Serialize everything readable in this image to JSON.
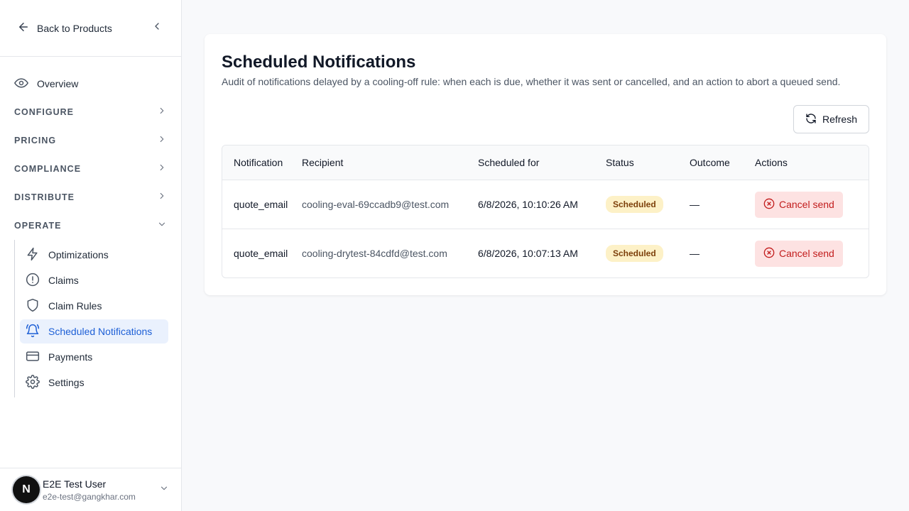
{
  "sidebar": {
    "back_label": "Back to Products",
    "overview_label": "Overview",
    "groups": [
      {
        "label": "CONFIGURE"
      },
      {
        "label": "PRICING"
      },
      {
        "label": "COMPLIANCE"
      },
      {
        "label": "DISTRIBUTE"
      },
      {
        "label": "OPERATE"
      }
    ],
    "operate_items": [
      {
        "label": "Optimizations",
        "icon": "bolt-icon"
      },
      {
        "label": "Claims",
        "icon": "alert-circle-icon"
      },
      {
        "label": "Claim Rules",
        "icon": "shield-icon"
      },
      {
        "label": "Scheduled Notifications",
        "icon": "bell-ring-icon",
        "active": true
      },
      {
        "label": "Payments",
        "icon": "credit-card-icon"
      },
      {
        "label": "Settings",
        "icon": "gear-icon"
      }
    ]
  },
  "user": {
    "initial": "N",
    "name": "E2E Test User",
    "email": "e2e-test@gangkhar.com"
  },
  "page": {
    "title": "Scheduled Notifications",
    "description": "Audit of notifications delayed by a cooling-off rule: when each is due, whether it was sent or cancelled, and an action to abort a queued send.",
    "refresh_label": "Refresh"
  },
  "table": {
    "headers": [
      "Notification",
      "Recipient",
      "Scheduled for",
      "Status",
      "Outcome",
      "Actions"
    ],
    "rows": [
      {
        "notification": "quote_email",
        "recipient": "cooling-eval-69ccadb9@test.com",
        "scheduled_for": "6/8/2026, 10:10:26 AM",
        "status": "Scheduled",
        "outcome": "—",
        "action": "Cancel send"
      },
      {
        "notification": "quote_email",
        "recipient": "cooling-drytest-84cdfd@test.com",
        "scheduled_for": "6/8/2026, 10:07:13 AM",
        "status": "Scheduled",
        "outcome": "—",
        "action": "Cancel send"
      }
    ]
  },
  "colors": {
    "accent": "#1d5fd6",
    "active_bg": "#eaf1fd",
    "badge_bg": "#fdf1c7",
    "danger": "#c21c1c",
    "danger_bg": "#fde2e2"
  }
}
